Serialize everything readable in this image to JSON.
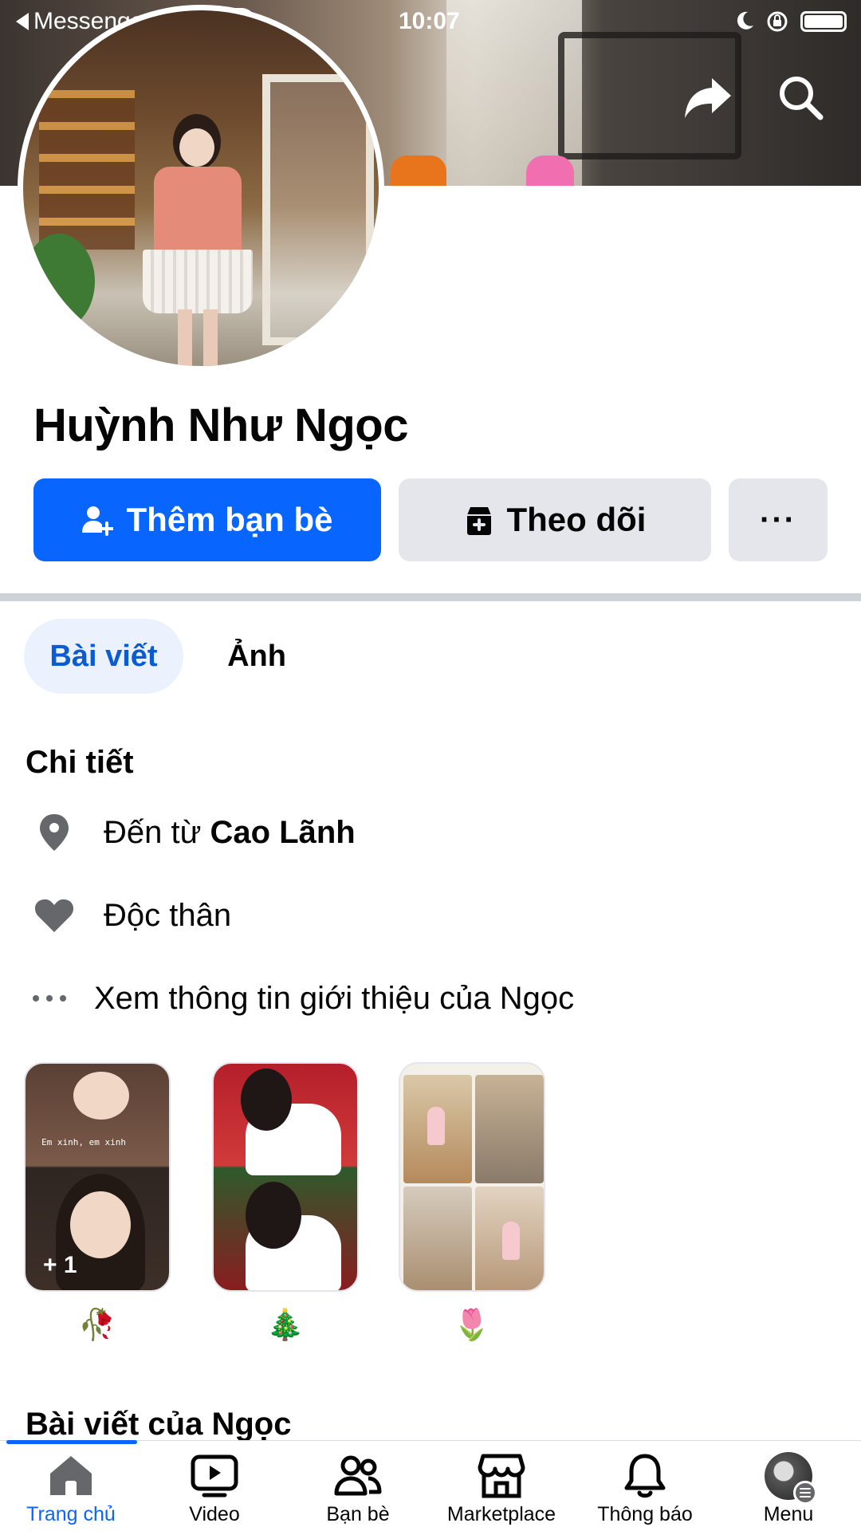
{
  "status_bar": {
    "back_app": "Messenger",
    "time": "10:07"
  },
  "cover": {
    "back_icon": "chevron-left-icon",
    "share_icon": "share-arrow-icon",
    "search_icon": "search-icon"
  },
  "profile": {
    "name": "Huỳnh Như Ngọc"
  },
  "actions": {
    "add_friend_label": "Thêm bạn bè",
    "follow_label": "Theo dõi",
    "more_label": "···"
  },
  "tabs": [
    {
      "label": "Bài viết",
      "active": true
    },
    {
      "label": "Ảnh",
      "active": false
    }
  ],
  "details": {
    "title": "Chi tiết",
    "from_prefix": "Đến từ",
    "from_place": "Cao Lãnh",
    "relationship": "Độc thân",
    "see_about": "Xem thông tin giới thiệu của Ngọc"
  },
  "featured": [
    {
      "caption": "Em xinh, em xinh",
      "more": "+ 1",
      "emoji": "🥀"
    },
    {
      "emoji": "🎄"
    },
    {
      "emoji": "🌷"
    }
  ],
  "posts_section": {
    "title": "Bài viết của Ngọc"
  },
  "bottom_nav": [
    {
      "label": "Trang chủ",
      "icon": "home-icon",
      "active": true
    },
    {
      "label": "Video",
      "icon": "video-icon",
      "active": false
    },
    {
      "label": "Bạn bè",
      "icon": "friends-icon",
      "active": false
    },
    {
      "label": "Marketplace",
      "icon": "marketplace-icon",
      "active": false
    },
    {
      "label": "Thông báo",
      "icon": "bell-icon",
      "active": false
    },
    {
      "label": "Menu",
      "icon": "menu-icon",
      "active": false
    }
  ],
  "colors": {
    "accent": "#0866ff",
    "button_gray": "#e4e6eb",
    "tab_active_bg": "#ebf2fd"
  }
}
